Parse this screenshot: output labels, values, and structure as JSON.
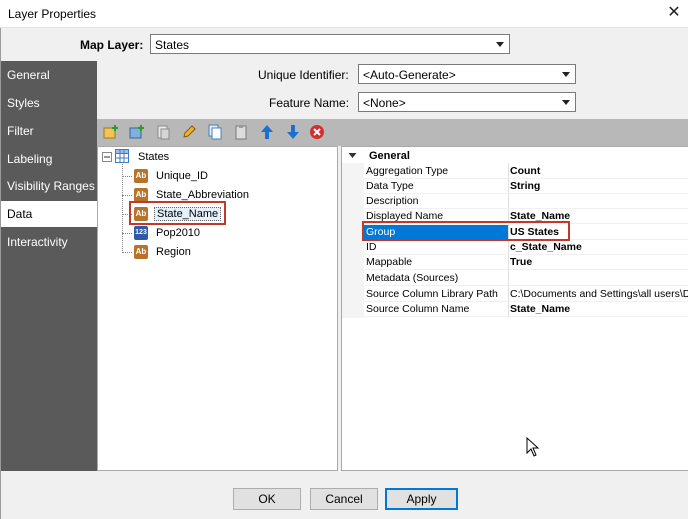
{
  "window": {
    "title": "Layer Properties"
  },
  "map_layer": {
    "label": "Map Layer:",
    "value": "States"
  },
  "sidebar": {
    "items": [
      {
        "label": "General"
      },
      {
        "label": "Styles"
      },
      {
        "label": "Filter"
      },
      {
        "label": "Labeling"
      },
      {
        "label": "Visibility Ranges"
      },
      {
        "label": "Data"
      },
      {
        "label": "Interactivity"
      }
    ],
    "active": "Data"
  },
  "data_tab": {
    "unique_identifier": {
      "label": "Unique Identifier:",
      "value": "<Auto-Generate>"
    },
    "feature_name": {
      "label": "Feature Name:",
      "value": "<None>"
    }
  },
  "toolbar": {
    "icons": [
      "add-column-icon",
      "add-calculated-column-icon",
      "copy-icon",
      "edit-icon",
      "duplicate-icon",
      "paste-icon",
      "move-up-icon",
      "move-down-icon",
      "delete-icon"
    ]
  },
  "tree": {
    "root": "States",
    "children": [
      {
        "label": "Unique_ID",
        "type": "text"
      },
      {
        "label": "State_Abbreviation",
        "type": "text"
      },
      {
        "label": "State_Name",
        "type": "text"
      },
      {
        "label": "Pop2010",
        "type": "number"
      },
      {
        "label": "Region",
        "type": "text"
      }
    ],
    "icon_text": {
      "text": "Ab",
      "number": "123"
    }
  },
  "properties": {
    "section": "General",
    "rows": [
      {
        "key": "Aggregation Type",
        "value": "Count"
      },
      {
        "key": "Data Type",
        "value": "String"
      },
      {
        "key": "Description",
        "value": ""
      },
      {
        "key": "Displayed Name",
        "value": "State_Name"
      },
      {
        "key": "Group",
        "value": "US States"
      },
      {
        "key": "ID",
        "value": "c_State_Name"
      },
      {
        "key": "Mappable",
        "value": "True"
      },
      {
        "key": "Metadata (Sources)",
        "value": ""
      },
      {
        "key": "Source Column Library Path",
        "value": "C:\\Documents and Settings\\all users\\Do"
      },
      {
        "key": "Source Column Name",
        "value": "State_Name"
      }
    ]
  },
  "buttons": {
    "ok": "OK",
    "cancel": "Cancel",
    "apply": "Apply"
  },
  "colors": {
    "sidebar": "#5a5a5a",
    "selection": "#0078d7",
    "highlight": "#c0392b",
    "toolbar": "#b8b8b8"
  }
}
